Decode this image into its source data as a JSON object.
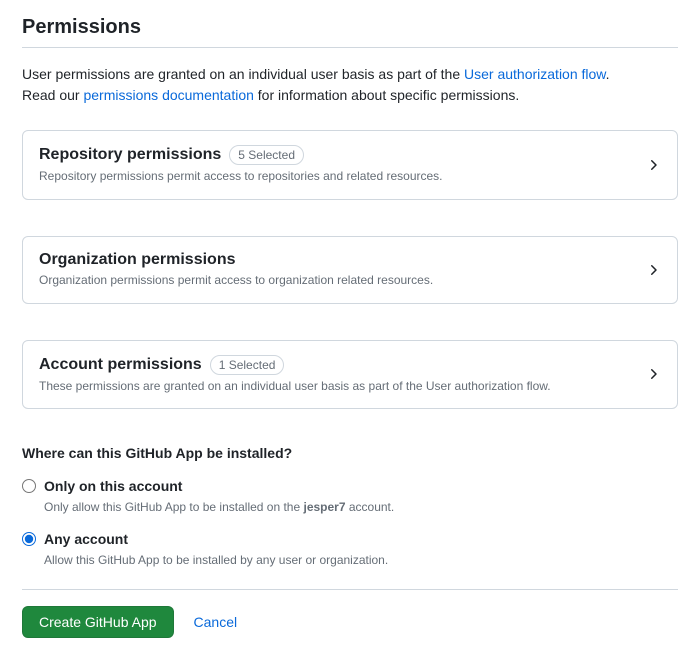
{
  "title": "Permissions",
  "intro": {
    "line1_prefix": "User permissions are granted on an individual user basis as part of the ",
    "line1_link": "User authorization flow",
    "line1_suffix": ".",
    "line2_prefix": "Read our ",
    "line2_link": "permissions documentation",
    "line2_suffix": " for information about specific permissions."
  },
  "cards": {
    "repository": {
      "title": "Repository permissions",
      "badge": "5 Selected",
      "desc": "Repository permissions permit access to repositories and related resources."
    },
    "organization": {
      "title": "Organization permissions",
      "desc": "Organization permissions permit access to organization related resources."
    },
    "account": {
      "title": "Account permissions",
      "badge": "1 Selected",
      "desc": "These permissions are granted on an individual user basis as part of the User authorization flow."
    }
  },
  "install": {
    "heading": "Where can this GitHub App be installed?",
    "options": {
      "only": {
        "label": "Only on this account",
        "desc_prefix": "Only allow this GitHub App to be installed on the ",
        "desc_account": "jesper7",
        "desc_suffix": " account."
      },
      "any": {
        "label": "Any account",
        "desc": "Allow this GitHub App to be installed by any user or organization."
      }
    },
    "selected": "any"
  },
  "actions": {
    "create": "Create GitHub App",
    "cancel": "Cancel"
  }
}
